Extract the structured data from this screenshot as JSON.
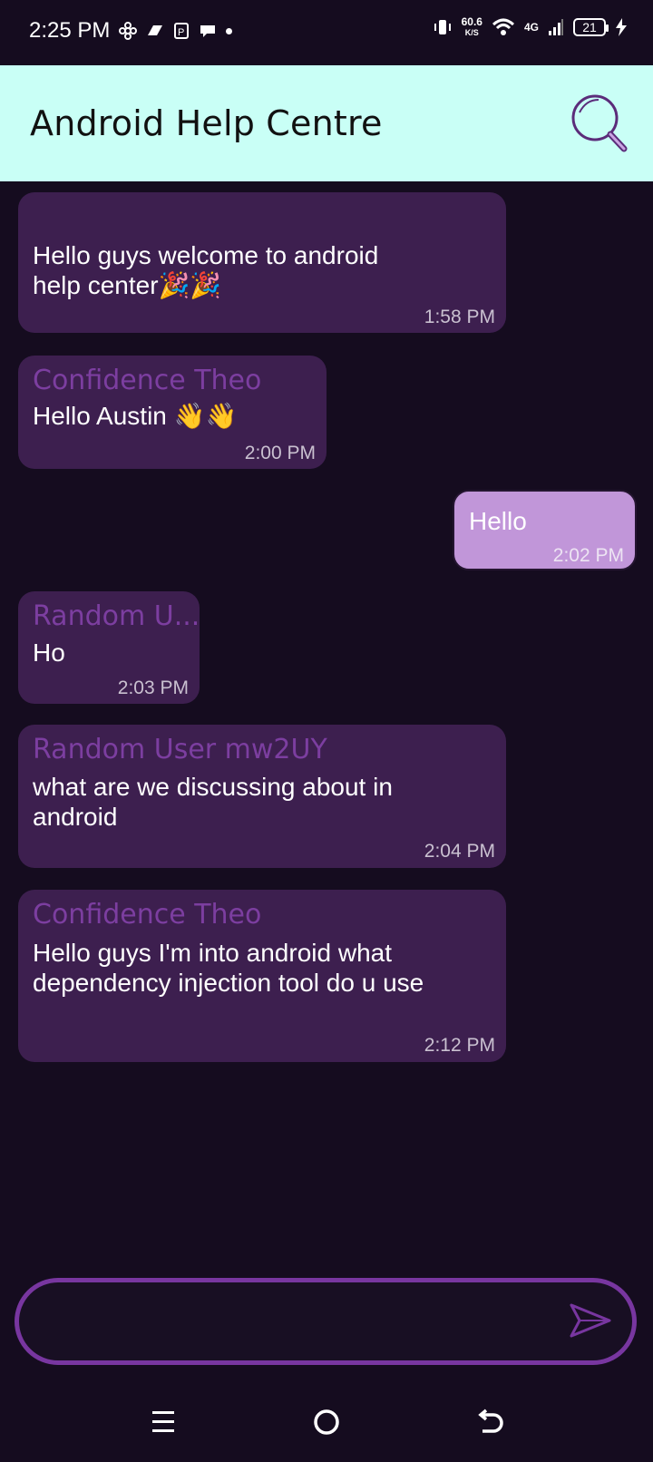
{
  "status_bar": {
    "time": "2:25 PM",
    "net_speed": "60.6",
    "net_speed_unit": "K/S",
    "network": "4G",
    "battery": "21"
  },
  "app_bar": {
    "title": "Android Help Centre",
    "search_icon": "search-icon"
  },
  "messages": [
    {
      "direction": "incoming",
      "sender": "",
      "text": "Hello guys welcome to android help center🎉🎉",
      "time": "1:58 PM"
    },
    {
      "direction": "incoming",
      "sender": "Confidence Theo",
      "text": "Hello Austin 👋👋",
      "time": "2:00 PM"
    },
    {
      "direction": "outgoing",
      "sender": "",
      "text": "Hello",
      "time": "2:02 PM"
    },
    {
      "direction": "incoming",
      "sender": "Random U...",
      "text": "Ho",
      "time": "2:03 PM"
    },
    {
      "direction": "incoming",
      "sender": "Random User mw2UY",
      "text": "what are we discussing about in android",
      "time": "2:04 PM"
    },
    {
      "direction": "incoming",
      "sender": "Confidence Theo",
      "text": "Hello guys I'm into android what dependency injection tool do u use",
      "time": "2:12 PM"
    }
  ],
  "composer": {
    "placeholder": "",
    "send_icon": "send-icon"
  },
  "colors": {
    "background": "#150c1f",
    "app_bar": "#c9fff6",
    "incoming_bubble": "#3d1f4f",
    "outgoing_bubble": "#c196d9",
    "sender_name": "#7c3ea0",
    "input_border": "#7836a0"
  }
}
